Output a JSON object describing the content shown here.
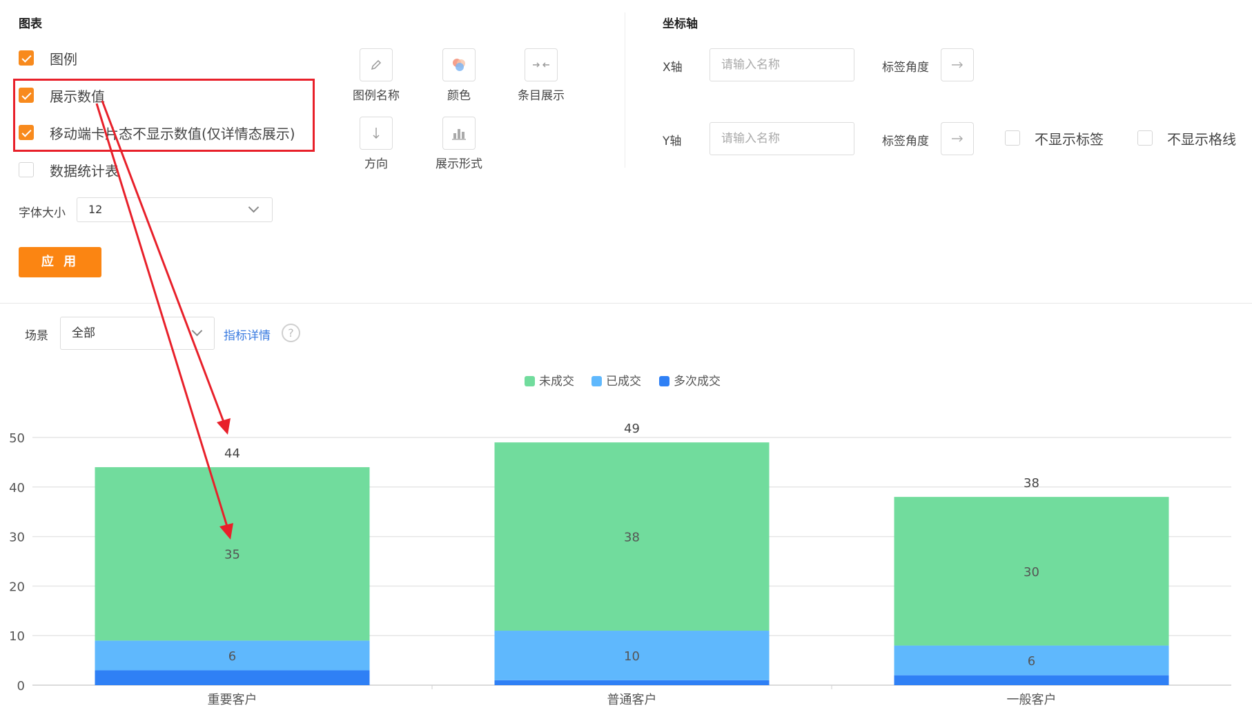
{
  "chart_panel": {
    "title": "图表",
    "checkboxes": [
      {
        "label": "图例",
        "checked": true
      },
      {
        "label": "展示数值",
        "checked": true
      },
      {
        "label": "移动端卡片态不显示数值(仅详情态展示)",
        "checked": true
      },
      {
        "label": "数据统计表",
        "checked": false
      }
    ],
    "tools": [
      {
        "label": "图例名称",
        "icon": "pencil-icon"
      },
      {
        "label": "颜色",
        "icon": "color-palette-icon"
      },
      {
        "label": "条目展示",
        "icon": "compress-arrows-icon"
      },
      {
        "label": "方向",
        "icon": "arrow-down-icon"
      },
      {
        "label": "展示形式",
        "icon": "bar-chart-icon"
      }
    ],
    "font_size_label": "字体大小",
    "font_size_value": "12",
    "apply_label": "应 用"
  },
  "axis_panel": {
    "title": "坐标轴",
    "x_label": "X轴",
    "x_placeholder": "请输入名称",
    "x_angle_label": "标签角度",
    "y_label": "Y轴",
    "y_placeholder": "请输入名称",
    "y_angle_label": "标签角度",
    "hide_labels": "不显示标签",
    "hide_grid": "不显示格线"
  },
  "filter": {
    "scene_label": "场景",
    "scene_value": "全部",
    "metric_link": "指标详情",
    "help_icon": "?"
  },
  "colors": {
    "accent": "#fb8512",
    "series_1": "#71dc9d",
    "series_2": "#5fb8fd",
    "series_3": "#2f80f5",
    "annotation": "#e8202a",
    "link": "#3a7be0"
  },
  "chart_data": {
    "type": "bar",
    "stacked": true,
    "categories": [
      "重要客户",
      "普通客户",
      "一般客户"
    ],
    "series": [
      {
        "name": "多次成交",
        "values": [
          3,
          1,
          2
        ],
        "color": "#2f80f5"
      },
      {
        "name": "已成交",
        "values": [
          6,
          10,
          6
        ],
        "color": "#5fb8fd"
      },
      {
        "name": "未成交",
        "values": [
          35,
          38,
          30
        ],
        "color": "#71dc9d"
      }
    ],
    "totals": [
      44,
      49,
      38
    ],
    "inner_labels": [
      {
        "category": "重要客户",
        "label": "6",
        "series": "已成交"
      },
      {
        "category": "重要客户",
        "label": "35",
        "series": "未成交"
      },
      {
        "category": "普通客户",
        "label": "10",
        "series": "已成交"
      },
      {
        "category": "普通客户",
        "label": "38",
        "series": "未成交"
      },
      {
        "category": "一般客户",
        "label": "6",
        "series": "已成交"
      },
      {
        "category": "一般客户",
        "label": "30",
        "series": "未成交"
      }
    ],
    "yticks": [
      "0",
      "10",
      "20",
      "30",
      "40",
      "50"
    ],
    "ylim": [
      0,
      50
    ],
    "legend_position": "top-center",
    "legend": [
      "未成交",
      "已成交",
      "多次成交"
    ],
    "grid": true
  }
}
